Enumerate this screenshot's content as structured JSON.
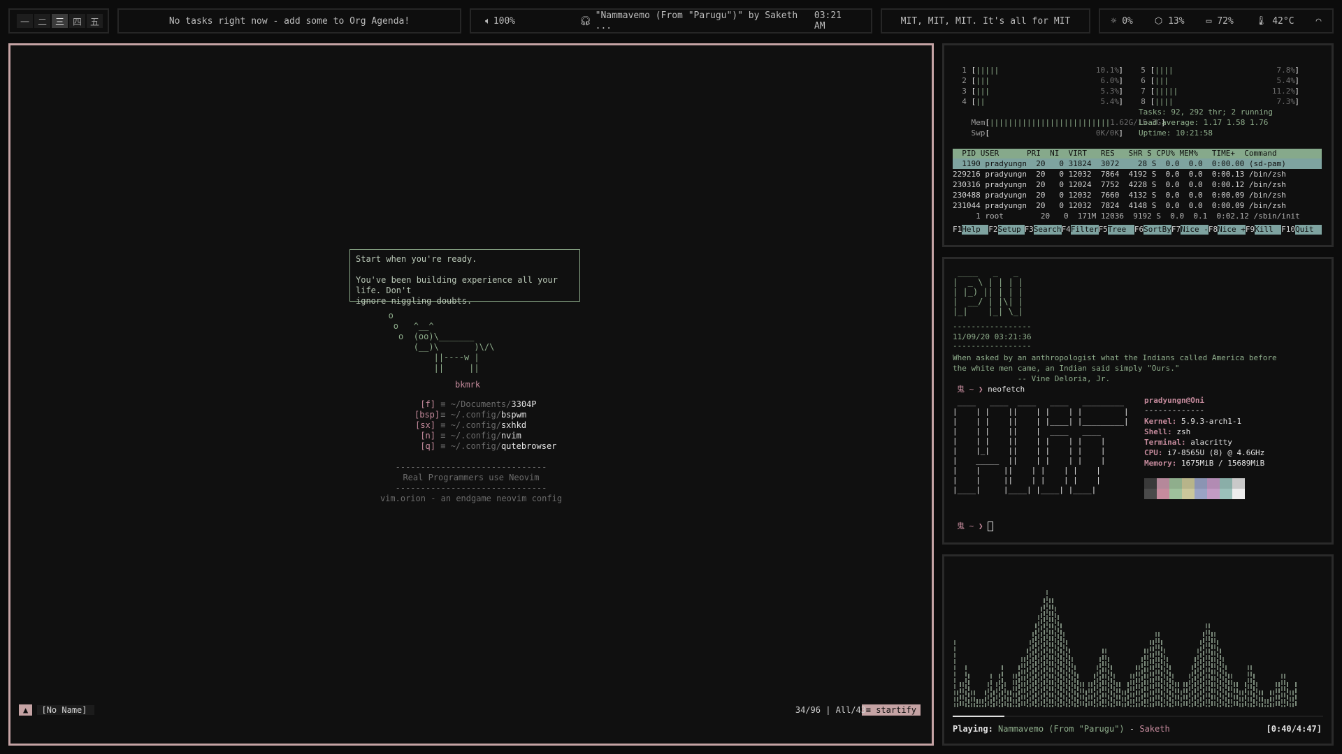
{
  "topbar": {
    "workspaces": [
      {
        "label": "一",
        "active": false
      },
      {
        "label": "二",
        "active": false
      },
      {
        "label": "三",
        "active": true
      },
      {
        "label": "四",
        "active": false
      },
      {
        "label": "五",
        "active": false
      }
    ],
    "agenda_text": "No tasks right now - add some to Org Agenda!",
    "volume": "100%",
    "now_playing": "\"Nammavemo (From \"Parugu\")\" by Saketh ...",
    "clock": "03:21 AM",
    "motto": "MIT, MIT, MIT. It's all for MIT",
    "brightness": "0%",
    "cpu": "13%",
    "battery": "72%",
    "temp": "42°C"
  },
  "editor": {
    "quote_line1": "Start when you're ready.",
    "quote_line2": "You've been building experience all your life. Don't",
    "quote_line3": "ignore niggling doubts.",
    "cow": "       o\n        o   ^__^\n         o  (oo)\\_______\n            (__)\\       )\\/\\\n                ||----w |\n                ||     ||",
    "bookmarks_title": "bkmrk",
    "bookmarks": [
      {
        "key": "f",
        "icon": "≡",
        "dir": "~/Documents/",
        "name": "3304P"
      },
      {
        "key": "bsp",
        "icon": "≡",
        "dir": "~/.config/",
        "name": "bspwm"
      },
      {
        "key": "sx",
        "icon": "≡",
        "dir": "~/.config/",
        "name": "sxhkd"
      },
      {
        "key": "n",
        "icon": "≡",
        "dir": "~/.config/",
        "name": "nvim"
      },
      {
        "key": "q",
        "icon": "≡",
        "dir": "~/.config/",
        "name": "qutebrowser"
      }
    ],
    "footer_rule": "------------------------------",
    "footer_text1": "Real Programmers use Neovim",
    "footer_text2": "vim.orion - an endgame neovim config",
    "status_mode": "▲",
    "status_file": "[No Name]",
    "status_pos": "34/96 | All/43",
    "status_ft": "≡ startify"
  },
  "htop": {
    "cpus_left": [
      {
        "n": "1",
        "bars": "|||||",
        "pct": "10.1%"
      },
      {
        "n": "2",
        "bars": "|||",
        "pct": "6.0%"
      },
      {
        "n": "3",
        "bars": "|||",
        "pct": "5.3%"
      },
      {
        "n": "4",
        "bars": "||",
        "pct": "5.4%"
      }
    ],
    "cpus_right": [
      {
        "n": "5",
        "bars": "||||",
        "pct": "7.8%"
      },
      {
        "n": "6",
        "bars": "|||",
        "pct": "5.4%"
      },
      {
        "n": "7",
        "bars": "|||||",
        "pct": "11.2%"
      },
      {
        "n": "8",
        "bars": "||||",
        "pct": "7.3%"
      }
    ],
    "mem_label": "Mem",
    "mem_bars": "||||||||||||||||||||||||||",
    "mem_val": "1.62G/15.3G",
    "swp_label": "Swp",
    "swp_val": "0K/0K",
    "tasks": "Tasks: 92, 292 thr; 2 running",
    "load": "Load average: 1.17 1.58 1.76",
    "uptime": "Uptime: 10:21:58",
    "header": "  PID USER      PRI  NI  VIRT   RES   SHR S CPU% MEM%   TIME+  Command",
    "rows": [
      "  1190 pradyungn  20   0 31824  3072    28 S  0.0  0.0  0:00.00 (sd-pam)",
      "229216 pradyungn  20   0 12032  7864  4192 S  0.0  0.0  0:00.13 /bin/zsh",
      "230316 pradyungn  20   0 12024  7752  4228 S  0.0  0.0  0:00.12 /bin/zsh",
      "230488 pradyungn  20   0 12032  7660  4132 S  0.0  0.0  0:00.09 /bin/zsh",
      "231044 pradyungn  20   0 12032  7824  4148 S  0.0  0.0  0:00.09 /bin/zsh",
      "     1 root        20   0  171M 12036  9192 S  0.0  0.1  0:02.12 /sbin/init"
    ],
    "fkeys": [
      {
        "k": "F1",
        "l": "Help"
      },
      {
        "k": "F2",
        "l": "Setup"
      },
      {
        "k": "F3",
        "l": "Search"
      },
      {
        "k": "F4",
        "l": "Filter"
      },
      {
        "k": "F5",
        "l": "Tree"
      },
      {
        "k": "F6",
        "l": "SortBy"
      },
      {
        "k": "F7",
        "l": "Nice -"
      },
      {
        "k": "F8",
        "l": "Nice +"
      },
      {
        "k": "F9",
        "l": "Kill"
      },
      {
        "k": "F10",
        "l": "Quit"
      }
    ]
  },
  "terminal": {
    "logo": " ____   _   _ \n|  _ \\ | | | |\n| |_) || | | |\n|  __/ | |\\| |\n|_|    |_| \\_|",
    "rule": "-----------------",
    "datetime": "11/09/20 03:21:36",
    "quote": "When asked by an anthropologist what the Indians called America before\nthe white men came, an Indian said simply \"Ours.\"",
    "quote_author": "              -- Vine Deloria, Jr.",
    "prompt_symbol": "鬼 ~ ❯",
    "command": "neofetch",
    "ascii_logo": " ____   ____  ____   ____   _________ \n|    | |    ||    | |    | |         |\n|    | |    ||    | |____| |_________|\n|    | |    ||    |  ____   ____      \n|    | |    ||    | |    | |    |     \n|    |_|    ||    | |    | |    |     \n|    _____  ||    | |    | |    |     \n|    |     ||    | |    | |    |     \n|    |     ||    | |    | |    |     \n|____|     |____| |____| |____|     ",
    "userhost": "pradyungn@Oni",
    "sep": "-------------",
    "info": [
      {
        "k": "Kernel",
        "v": "5.9.3-arch1-1"
      },
      {
        "k": "Shell",
        "v": "zsh"
      },
      {
        "k": "Terminal",
        "v": "alacritty"
      },
      {
        "k": "CPU",
        "v": "i7-8565U (8) @ 4.6GHz"
      },
      {
        "k": "Memory",
        "v": "1675MiB / 15689MiB"
      }
    ],
    "palette": [
      "#3a3a3a",
      "#b5889a",
      "#8fae8c",
      "#b7b48a",
      "#8b94b3",
      "#b28bb3",
      "#8aaea8",
      "#c9c9c9",
      "#4a4a4a",
      "#c68b9d",
      "#9fc19c",
      "#cbc79b",
      "#9aa3c4",
      "#c39bc4",
      "#9bc0ba",
      "#ededed"
    ],
    "prompt2": "鬼 ~ ❯"
  },
  "music": {
    "playing_label": "Playing:",
    "song": "Nammavemo (From \"Parugu\")",
    "dash": "-",
    "artist": "Saketh",
    "time": "[0:40/4:47]",
    "progress": 0.14,
    "bars": [
      8,
      2,
      3,
      3,
      5,
      4,
      2,
      2,
      1,
      1,
      1,
      2,
      3,
      4,
      2,
      3,
      4,
      5,
      3,
      2,
      2,
      4,
      4,
      5,
      6,
      6,
      7,
      8,
      9,
      10,
      11,
      12,
      13,
      14,
      13,
      13,
      12,
      11,
      10,
      9,
      8,
      7,
      6,
      5,
      4,
      3,
      3,
      2,
      3,
      3,
      4,
      5,
      6,
      7,
      7,
      6,
      5,
      4,
      3,
      3,
      2,
      2,
      3,
      4,
      4,
      5,
      5,
      6,
      7,
      7,
      8,
      8,
      9,
      9,
      8,
      7,
      6,
      5,
      4,
      3,
      3,
      2,
      3,
      3,
      4,
      5,
      6,
      7,
      8,
      9,
      10,
      10,
      9,
      9,
      8,
      7,
      6,
      5,
      4,
      4,
      3,
      3,
      2,
      2,
      3,
      5,
      5,
      4,
      3,
      2,
      2,
      1,
      1,
      2,
      2,
      3,
      3,
      4,
      4,
      3,
      2,
      2,
      3
    ]
  }
}
